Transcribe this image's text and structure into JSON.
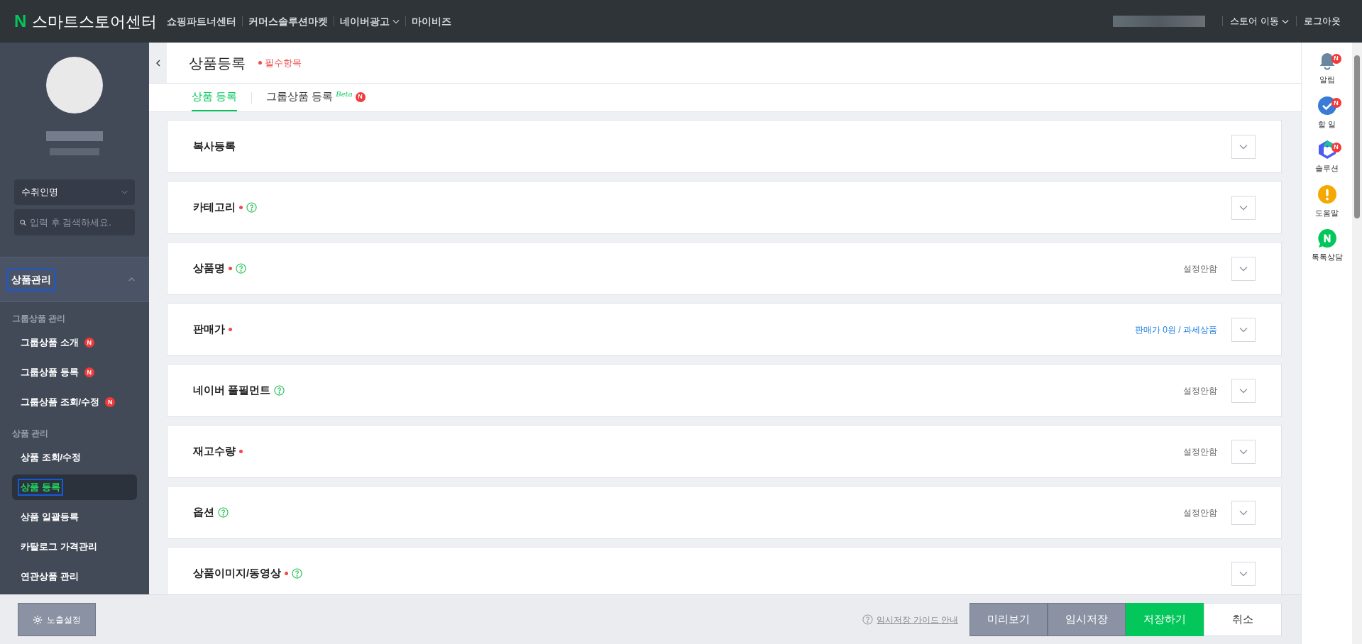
{
  "top_bar": {
    "logo_mark": "N",
    "logo_text": "스마트스토어센터",
    "nav": [
      {
        "label": "쇼핑파트너센터",
        "dropdown": false
      },
      {
        "label": "커머스솔루션마켓",
        "dropdown": false
      },
      {
        "label": "네이버광고",
        "dropdown": true
      },
      {
        "label": "마이비즈",
        "dropdown": false
      }
    ],
    "right": [
      {
        "label": "스토어 이동",
        "dropdown": true
      },
      {
        "label": "로그아웃",
        "dropdown": false
      }
    ]
  },
  "sidebar": {
    "select": {
      "value": "수취인명"
    },
    "search": {
      "placeholder": "입력 후 검색하세요."
    },
    "section": {
      "label": "상품관리",
      "expanded": true,
      "outlined": true
    },
    "groups": [
      {
        "heading": "그룹상품 관리",
        "items": [
          {
            "label": "그룹상품 소개",
            "badge": "N",
            "selected": false,
            "outlined": false
          },
          {
            "label": "그룹상품 등록",
            "badge": "N",
            "selected": false,
            "outlined": false
          },
          {
            "label": "그룹상품 조회/수정",
            "badge": "N",
            "selected": false,
            "outlined": false
          }
        ]
      },
      {
        "heading": "상품 관리",
        "items": [
          {
            "label": "상품 조회/수정",
            "selected": false,
            "outlined": false
          },
          {
            "label": "상품 등록",
            "selected": true,
            "outlined": true
          },
          {
            "label": "상품 일괄등록",
            "selected": false,
            "outlined": false
          },
          {
            "label": "카탈로그 가격관리",
            "selected": false,
            "outlined": false
          },
          {
            "label": "연관상품 관리",
            "selected": false,
            "outlined": false
          }
        ]
      }
    ],
    "settings_button": "노출설정"
  },
  "page": {
    "title": "상품등록",
    "required_note": "필수항목",
    "tabs": [
      {
        "label": "상품 등록",
        "selected": true
      },
      {
        "label": "그룹상품 등록",
        "tag": "Beta",
        "badge": "N",
        "selected": false
      }
    ],
    "sections": [
      {
        "title": "복사등록",
        "required": false,
        "help": false
      },
      {
        "title": "카테고리",
        "required": true,
        "help": true
      },
      {
        "title": "상품명",
        "required": true,
        "help": true,
        "status": {
          "text": "설정안함",
          "kind": "plain"
        }
      },
      {
        "title": "판매가",
        "required": true,
        "help": false,
        "status": {
          "text": "판매가 0원 / 과세상품",
          "kind": "highlight"
        }
      },
      {
        "title": "네이버 풀필먼트",
        "required": false,
        "help": true,
        "status": {
          "text": "설정안함",
          "kind": "plain"
        }
      },
      {
        "title": "재고수량",
        "required": true,
        "help": false,
        "status": {
          "text": "설정안함",
          "kind": "plain"
        }
      },
      {
        "title": "옵션",
        "required": false,
        "help": true,
        "status": {
          "text": "설정안함",
          "kind": "plain"
        }
      },
      {
        "title": "상품이미지/동영상",
        "required": true,
        "help": true
      }
    ]
  },
  "footer": {
    "guide_link": "임시저장 가이드 안내",
    "buttons": [
      {
        "label": "미리보기",
        "kind": "secondary"
      },
      {
        "label": "임시저장",
        "kind": "secondary"
      },
      {
        "label": "저장하기",
        "kind": "primary"
      },
      {
        "label": "취소",
        "kind": "plain"
      }
    ]
  },
  "right_rail": [
    {
      "label": "알림",
      "kind": "bell",
      "badge": "N"
    },
    {
      "label": "할 일",
      "kind": "check",
      "badge": "N"
    },
    {
      "label": "솔루션",
      "kind": "solution",
      "badge": "N"
    },
    {
      "label": "도움말",
      "kind": "help"
    },
    {
      "label": "톡톡상담",
      "kind": "talk"
    }
  ]
}
